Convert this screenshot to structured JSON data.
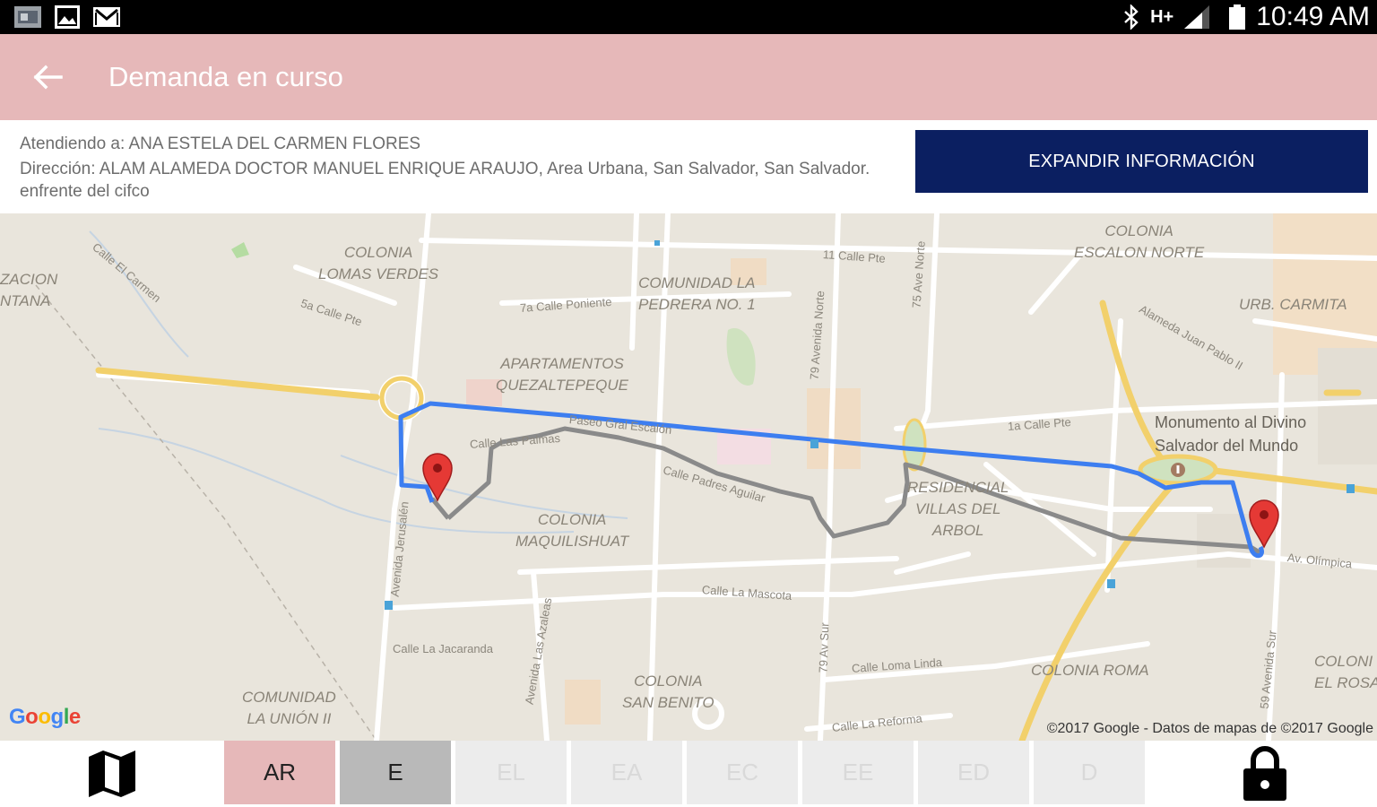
{
  "status_bar": {
    "time": "10:49 AM",
    "network": "H+"
  },
  "app_bar": {
    "title": "Demanda en curso",
    "back_icon": "arrow-left-icon"
  },
  "info": {
    "attending": "Atendiendo a: ANA ESTELA DEL CARMEN FLORES",
    "address": "Dirección: ALAM ALAMEDA DOCTOR MANUEL ENRIQUE ARAUJO, Area Urbana, San Salvador, San Salvador. enfrente del cifco",
    "expand_button": "EXPANDIR INFORMACIÓN"
  },
  "map": {
    "neighborhoods": [
      "COLONIA\nLOMAS VERDES",
      "ZACION\nNTANA",
      "COMUNIDAD LA\nPEDRERA NO. 1",
      "COLONIA\nESCALON NORTE",
      "URB. CARMITA",
      "APARTAMENTOS\nQUEZALTEPEQUE",
      "RESIDENCIAL\nVILLAS DEL\nARBOL",
      "COLONIA\nMAQUILISHUAT",
      "COLONIA\nSAN BENITO",
      "COMUNIDAD\nLA UNIÓN II",
      "COLONIA ROMA",
      "COLONI\nEL ROSA"
    ],
    "streets": [
      "Calle El Carmen",
      "5a Calle Pte",
      "7a Calle Poniente",
      "11 Calle Pte",
      "75 Ave Norte",
      "79 Avenida Norte",
      "Alameda Juan Pablo II",
      "1a Calle Pte",
      "Paseo Gral Escalón",
      "Calle Las Palmas",
      "Calle Padres Aguilar",
      "Avenida Jerusalén",
      "Calle La Mascota",
      "Calle La Jacaranda",
      "Avenida Las Azaleas",
      "79 Av Sur",
      "Calle Loma Linda",
      "Calle La Reforma",
      "Av. Olímpica",
      "59 Avenida Sur"
    ],
    "poi": "Monumento al Divino\nSalvador del Mundo",
    "logo": "Google",
    "copyright": "©2017 Google - Datos de mapas de ©2017 Google",
    "colors": {
      "route_active": "#3d7ef0",
      "route_alt": "#888888",
      "highway": "#f2d06b",
      "marker": "#e53935"
    },
    "markers": [
      "destination-marker",
      "origin-marker"
    ]
  },
  "bottom_bar": {
    "map_icon": "map-icon",
    "lock_icon": "lock-icon",
    "tabs": [
      {
        "label": "AR",
        "state": "active"
      },
      {
        "label": "E",
        "state": "done"
      },
      {
        "label": "EL",
        "state": "pending"
      },
      {
        "label": "EA",
        "state": "pending"
      },
      {
        "label": "EC",
        "state": "pending"
      },
      {
        "label": "EE",
        "state": "pending"
      },
      {
        "label": "ED",
        "state": "pending"
      },
      {
        "label": "D",
        "state": "pending"
      }
    ]
  }
}
